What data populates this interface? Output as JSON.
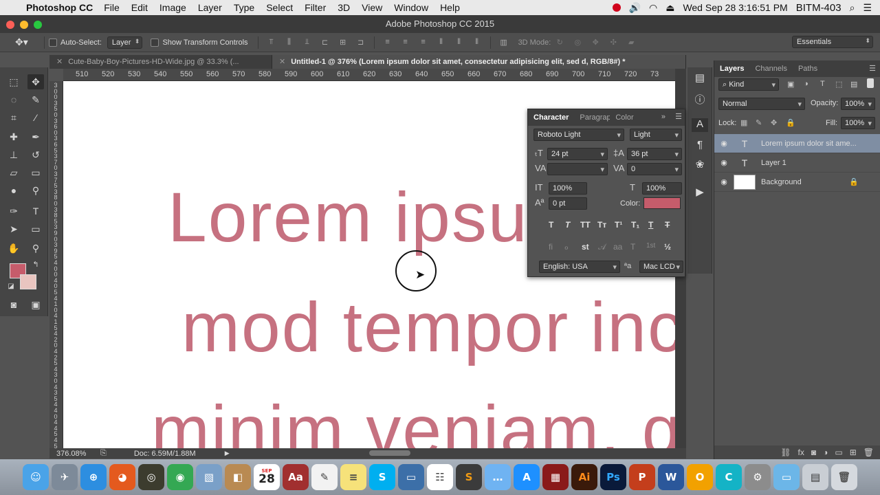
{
  "menubar": {
    "app_name": "Photoshop CC",
    "items": [
      "File",
      "Edit",
      "Image",
      "Layer",
      "Type",
      "Select",
      "Filter",
      "3D",
      "View",
      "Window",
      "Help"
    ],
    "datetime": "Wed Sep 28  3:16:51 PM",
    "user": "BITM-403"
  },
  "window": {
    "title": "Adobe Photoshop CC 2015"
  },
  "options": {
    "auto_select_label": "Auto-Select:",
    "auto_select_value": "Layer",
    "transform_label": "Show Transform Controls",
    "mode_label": "3D Mode:",
    "workspace": "Essentials"
  },
  "tabs": [
    {
      "label": "Cute-Baby-Boy-Pictures-HD-Wide.jpg @ 33.3% (..."
    },
    {
      "label": "Untitled-1 @ 376% (Lorem ipsum dolor sit amet, consectetur adipisicing elit, sed d, RGB/8#) *"
    }
  ],
  "ruler": {
    "h": [
      "510",
      "520",
      "530",
      "540",
      "550",
      "560",
      "570",
      "580",
      "590",
      "600",
      "610",
      "620",
      "630",
      "640",
      "650",
      "660",
      "670",
      "680",
      "690",
      "700",
      "710",
      "720",
      "73"
    ],
    "v": [
      "3",
      "0",
      "0",
      "3",
      "5",
      "0",
      "3",
      "6",
      "0",
      "3",
      "6",
      "5",
      "3",
      "7",
      "0",
      "3",
      "7",
      "5",
      "3",
      "8",
      "0",
      "3",
      "8",
      "5",
      "3",
      "9",
      "0",
      "3",
      "9",
      "5",
      "4",
      "0",
      "0",
      "4",
      "0",
      "5",
      "4",
      "1",
      "0",
      "4",
      "1",
      "5",
      "4",
      "2",
      "0",
      "4",
      "2",
      "5",
      "4",
      "3",
      "0",
      "4",
      "3",
      "5",
      "4",
      "4",
      "0",
      "4",
      "4",
      "5",
      "4",
      "5",
      "0"
    ]
  },
  "canvas": {
    "line1": "Lorem ipsum",
    "line2": "mod tempor inci",
    "line3": "minim veniam, qu",
    "text_color": "#c46a7a"
  },
  "status": {
    "zoom": "376.08%",
    "doc": "Doc: 6.59M/1.88M"
  },
  "character": {
    "tabs": [
      "Character",
      "Paragraph",
      "Color"
    ],
    "font_family": "Roboto Light",
    "font_style": "Light",
    "size": "24 pt",
    "leading": "36 pt",
    "kerning": "",
    "tracking": "0",
    "vscale": "100%",
    "hscale": "100%",
    "baseline": "0 pt",
    "color_label": "Color:",
    "color": "#c65c6b",
    "style_buttons": [
      "T",
      "T",
      "TT",
      "Tт",
      "T¹",
      "T₁",
      "T",
      "T"
    ],
    "opentype_buttons": [
      "fi",
      "ℴ",
      "st",
      "𝒜",
      "aa",
      "T",
      "1st",
      "½"
    ],
    "language": "English: USA",
    "aa_label": "ªa",
    "antialias": "Mac LCD"
  },
  "layers": {
    "tabs": [
      "Layers",
      "Channels",
      "Paths"
    ],
    "filter": "Kind",
    "blend_mode": "Normal",
    "opacity_label": "Opacity:",
    "opacity": "100%",
    "lock_label": "Lock:",
    "fill_label": "Fill:",
    "fill": "100%",
    "items": [
      {
        "name": "Lorem ipsum dolor sit ame...",
        "type": "text",
        "selected": true
      },
      {
        "name": "Layer 1",
        "type": "text",
        "selected": false
      },
      {
        "name": "Background",
        "type": "image",
        "selected": false,
        "locked": true
      }
    ]
  },
  "colors": {
    "foreground": "#c65c6b",
    "background": "#e9c5c0"
  },
  "dock": {
    "icons": [
      "finder-icon",
      "launchpad-icon",
      "safari-icon",
      "firefox-icon",
      "network-icon",
      "chrome-icon",
      "preview-icon",
      "contacts-icon",
      "calendar-icon",
      "dictionary-icon",
      "textedit-icon",
      "notes-icon",
      "skype-icon",
      "screen-icon",
      "reminders-icon",
      "sublime-icon",
      "messages-icon",
      "appstore-icon",
      "photobooth-icon",
      "illustrator-icon",
      "photoshop-icon",
      "powerpoint-icon",
      "word-icon",
      "pages-icon",
      "c-icon",
      "system-preferences-icon",
      "folder-icon",
      "network-folder-icon",
      "trash-icon"
    ],
    "calendar_month": "SEP",
    "calendar_day": "28",
    "illustrator_label": "Ai",
    "photoshop_label": "Ps"
  }
}
